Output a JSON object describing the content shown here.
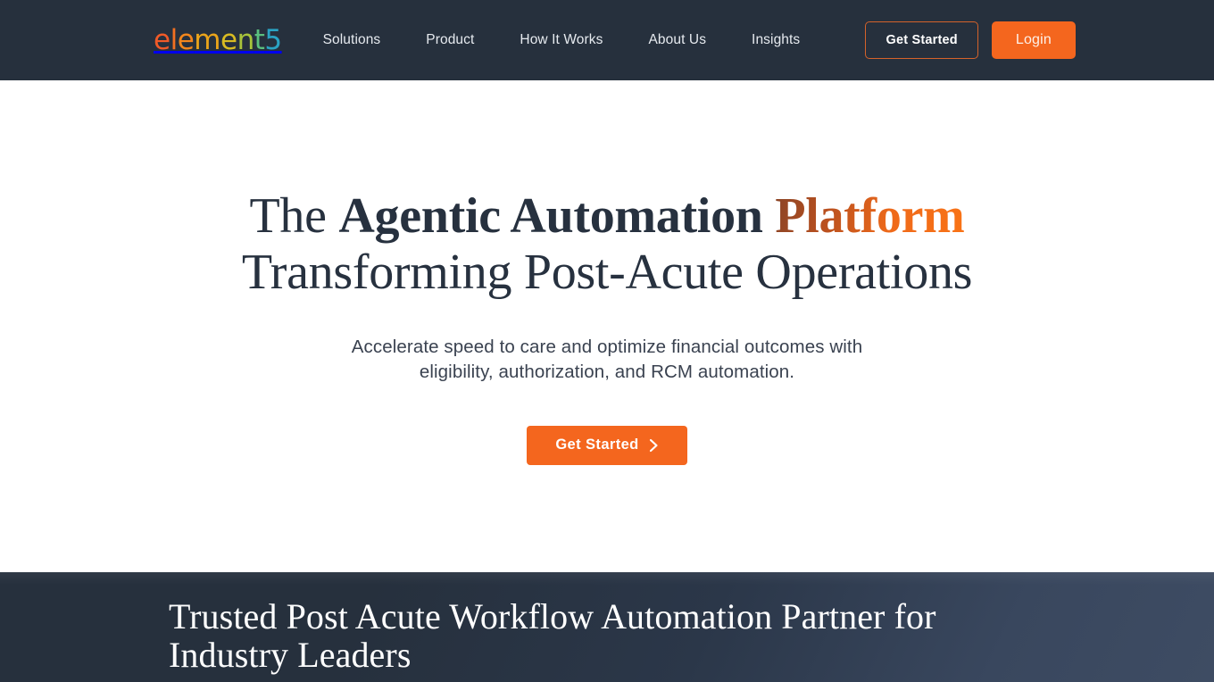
{
  "colors": {
    "header_bg": "#26303d",
    "accent_orange": "#f4661e",
    "hero_bg": "#ffffff",
    "heading_navy": "#27313f",
    "band_bg_left": "#26303d",
    "band_bg_right": "#3e4c63"
  },
  "header": {
    "logo": {
      "name": "element5",
      "letters": [
        {
          "ch": "e",
          "color": "#f05a28"
        },
        {
          "ch": "l",
          "color": "#f27021"
        },
        {
          "ch": "e",
          "color": "#f2861c"
        },
        {
          "ch": "m",
          "color": "#eaa41b"
        },
        {
          "ch": "e",
          "color": "#d8bb22"
        },
        {
          "ch": "n",
          "color": "#a9c43a"
        },
        {
          "ch": "t",
          "color": "#5bbf7e"
        },
        {
          "ch": "5",
          "color": "#2aa3c4"
        }
      ]
    },
    "nav": [
      {
        "label": "Solutions"
      },
      {
        "label": "Product"
      },
      {
        "label": "How It Works"
      },
      {
        "label": "About Us"
      },
      {
        "label": "Insights"
      }
    ],
    "get_started_label": "Get Started",
    "login_label": "Login"
  },
  "hero": {
    "title_part1": "The ",
    "title_part2": "Agentic Automation ",
    "title_accent": "Platform",
    "title_line2": "Transforming Post-Acute Operations",
    "subtitle": "Accelerate speed to care and optimize financial outcomes with eligibility, authorization, and RCM automation.",
    "cta_label": "Get Started",
    "cta_icon": "chevron-right-icon"
  },
  "trusted_band": {
    "title": "Trusted Post Acute Workflow Automation Partner for Industry Leaders"
  }
}
